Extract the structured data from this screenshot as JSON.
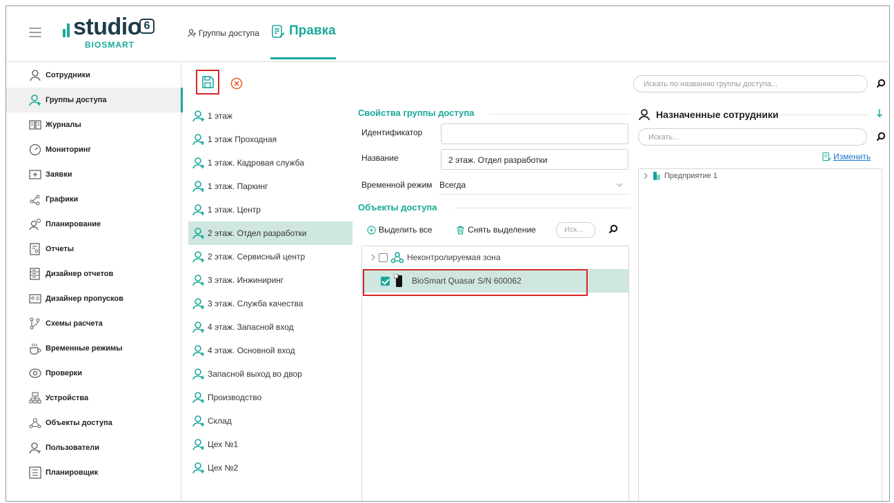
{
  "header": {
    "logo_word": "studio",
    "logo_version": "6",
    "logo_sub": "BIOSMART",
    "breadcrumb": "Группы доступа",
    "active_tab": "Правка"
  },
  "sidebar": {
    "items": [
      {
        "label": "Сотрудники",
        "icon": "person-icon"
      },
      {
        "label": "Группы доступа",
        "icon": "group-icon",
        "active": true
      },
      {
        "label": "Журналы",
        "icon": "journal-icon"
      },
      {
        "label": "Мониторинг",
        "icon": "gauge-icon"
      },
      {
        "label": "Заявки",
        "icon": "request-icon"
      },
      {
        "label": "Графики",
        "icon": "schedule-icon"
      },
      {
        "label": "Планирование",
        "icon": "planning-icon"
      },
      {
        "label": "Отчеты",
        "icon": "report-icon"
      },
      {
        "label": "Дизайнер отчетов",
        "icon": "report-designer-icon"
      },
      {
        "label": "Дизайнер пропусков",
        "icon": "pass-designer-icon"
      },
      {
        "label": "Схемы расчета",
        "icon": "calc-scheme-icon"
      },
      {
        "label": "Временные режимы",
        "icon": "time-mode-icon"
      },
      {
        "label": "Проверки",
        "icon": "eye-icon"
      },
      {
        "label": "Устройства",
        "icon": "devices-icon"
      },
      {
        "label": "Объекты доступа",
        "icon": "access-objects-icon"
      },
      {
        "label": "Пользователи",
        "icon": "users-icon"
      },
      {
        "label": "Планировщик",
        "icon": "scheduler-icon"
      }
    ]
  },
  "toolbar": {
    "save_icon": "save-icon",
    "cancel_icon": "cancel-icon"
  },
  "groups": [
    {
      "label": "1 этаж"
    },
    {
      "label": "1 этаж Проходная"
    },
    {
      "label": "1 этаж. Кадровая служба"
    },
    {
      "label": "1 этаж. Паркинг"
    },
    {
      "label": "1 этаж. Центр"
    },
    {
      "label": "2 этаж. Отдел разработки",
      "selected": true
    },
    {
      "label": "2 этаж. Сервисный центр"
    },
    {
      "label": "3 этаж. Инжиниринг"
    },
    {
      "label": "3 этаж. Служба качества"
    },
    {
      "label": "4 этаж. Запасной вход"
    },
    {
      "label": "4 этаж. Основной вход"
    },
    {
      "label": "Запасной выход во двор"
    },
    {
      "label": "Производство"
    },
    {
      "label": "Склад"
    },
    {
      "label": "Цех №1"
    },
    {
      "label": "Цех №2"
    }
  ],
  "properties": {
    "title": "Свойства группы доступа",
    "id_label": "Идентификатор",
    "id_value": "",
    "name_label": "Название",
    "name_value": "2 этаж. Отдел разработки",
    "mode_label": "Временной режим",
    "mode_value": "Всегда"
  },
  "objects": {
    "title": "Объекты доступа",
    "select_all": "Выделить все",
    "deselect": "Снять выделение",
    "search_placeholder": "Иск...",
    "rows": [
      {
        "label": "Неконтролируемая зона",
        "checked": false
      },
      {
        "label": "BioSmart Quasar S/N 600062",
        "checked": true
      }
    ]
  },
  "right": {
    "search_placeholder": "Искать по названию группы доступа...",
    "employees_title": "Назначенные сотрудники",
    "employees_search_placeholder": "Искать...",
    "change_label": "Изменить",
    "tree_root": "Предприятие 1"
  },
  "colors": {
    "accent": "#1aa89a",
    "highlight": "#d6262b",
    "selected_row": "#cfe6e1"
  }
}
